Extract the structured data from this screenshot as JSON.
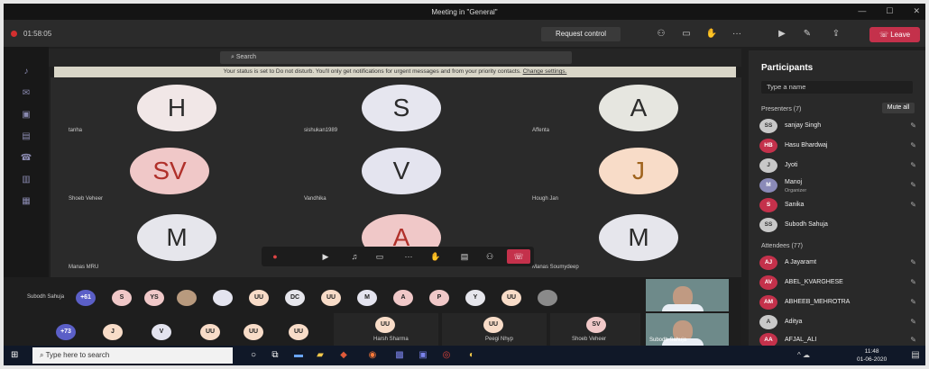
{
  "window": {
    "title": "Meeting in \"General\"",
    "controls": [
      "—",
      "☐",
      "✕"
    ]
  },
  "toolbar": {
    "timer": "01:58:05",
    "request_control": "Request control",
    "leave": "Leave",
    "icons": [
      "people-icon",
      "chat-icon",
      "hand-icon",
      "more-icon",
      "camera-icon",
      "mic-off-icon",
      "share-icon"
    ]
  },
  "search": {
    "placeholder": "Search"
  },
  "banner": {
    "text": "Your status is set to Do not disturb. You'll only get notifications for urgent messages and from your priority contacts.",
    "link": "Change settings."
  },
  "tiles": [
    {
      "initials": "H",
      "name": "tanha",
      "bg": "#f1e7e7",
      "fg": "#2b2b2b"
    },
    {
      "initials": "S",
      "name": "sishukan1989",
      "bg": "#e6e6ef",
      "fg": "#2b2b2b"
    },
    {
      "initials": "A",
      "name": "Affenta",
      "bg": "#e6e6e0",
      "fg": "#2b2b2b"
    },
    {
      "initials": "SV",
      "name": "Shoeb Veheer",
      "bg": "#f0c8c8",
      "fg": "#b0302a"
    },
    {
      "initials": "V",
      "name": "Vandhika",
      "bg": "#e4e4ef",
      "fg": "#2b2b2b"
    },
    {
      "initials": "J",
      "name": "Hough Jan",
      "bg": "#f8dcc8",
      "fg": "#a0641e"
    },
    {
      "initials": "M",
      "name": "Manas MRU",
      "bg": "#e6e6ec",
      "fg": "#2b2b2b"
    },
    {
      "initials": "A",
      "name": "",
      "bg": "#f0c8c8",
      "fg": "#b0302a"
    },
    {
      "initials": "M",
      "name": "Manas Soumydeep",
      "bg": "#e6e6ec",
      "fg": "#2b2b2b"
    }
  ],
  "strip": {
    "row1_label": "Subodh Sahuja",
    "row1_count": "+61",
    "row1": [
      "S",
      "YS",
      "",
      "UU",
      "DC",
      "UU",
      "M",
      "A",
      "P",
      "Y",
      "UU",
      ""
    ],
    "row2_count": "+73",
    "row2": [
      "J",
      "V",
      "UU",
      "UU",
      "UU"
    ],
    "tile_names": [
      "Harsh Sharma",
      "Peegi Nhyp",
      "Shoeb Veheer"
    ],
    "tile_initials": [
      "UU",
      "UU",
      "SV"
    ],
    "video_names": [
      "",
      "Subodh Sahuja"
    ]
  },
  "participants": {
    "title": "Participants",
    "search_placeholder": "Type a name",
    "presenters_head": "Presenters (7)",
    "mute_all": "Mute all",
    "presenters": [
      {
        "initials": "SS",
        "name": "sanjay Singh",
        "sub": ""
      },
      {
        "initials": "HB",
        "name": "Hasu Bhardwaj",
        "sub": ""
      },
      {
        "initials": "J",
        "name": "Jyoti",
        "sub": ""
      },
      {
        "initials": "M",
        "name": "Manoj",
        "sub": "Organizer"
      },
      {
        "initials": "S",
        "name": "Sanika",
        "sub": ""
      }
    ],
    "host": {
      "initials": "SS",
      "name": "Subodh Sahuja"
    },
    "attendees_head": "Attendees (77)",
    "attendees": [
      {
        "initials": "AJ",
        "name": "A Jayaramt"
      },
      {
        "initials": "AV",
        "name": "ABEL_KVARGHESE"
      },
      {
        "initials": "AM",
        "name": "ABHEEB_MEHROTRA"
      },
      {
        "initials": "A",
        "name": "Aditya"
      },
      {
        "initials": "AA",
        "name": "AFJAL_ALI"
      }
    ]
  },
  "taskbar": {
    "search_placeholder": "Type here to search",
    "time": "11:48",
    "date": "01-06-2020"
  }
}
